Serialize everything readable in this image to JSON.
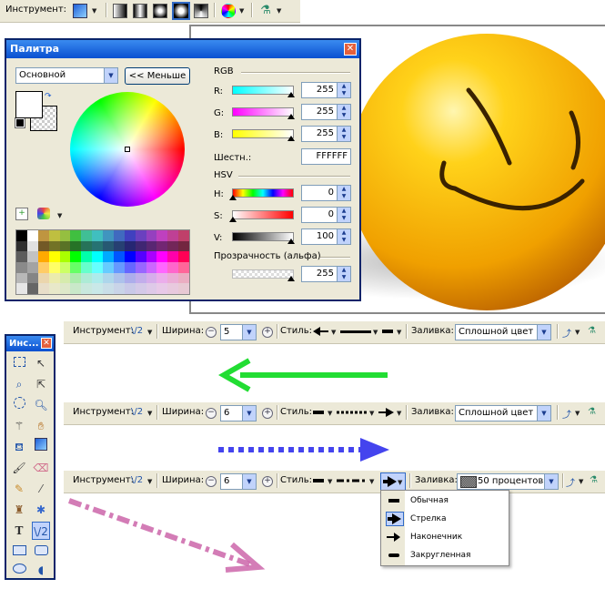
{
  "top_toolbar": {
    "tool_label": "Инструмент:"
  },
  "palette": {
    "title": "Палитра",
    "mode": "Основной",
    "less_button": "<< Меньше",
    "rgb_label": "RGB",
    "r_label": "R:",
    "g_label": "G:",
    "b_label": "B:",
    "r_value": "255",
    "g_value": "255",
    "b_value": "255",
    "hex_label": "Шестн.:",
    "hex_value": "FFFFFF",
    "hsv_label": "HSV",
    "h_label": "H:",
    "s_label": "S:",
    "v_label": "V:",
    "h_value": "0",
    "s_value": "0",
    "v_value": "100",
    "alpha_label": "Прозрачность (альфа)",
    "alpha_value": "255"
  },
  "tools_window": {
    "title": "Инс..."
  },
  "line_toolbars": [
    {
      "tool_label": "Инструмент:",
      "width_label": "Ширина:",
      "width_value": "5",
      "style_label": "Стиль:",
      "fill_label": "Заливка:",
      "fill_value": "Сплошной цвет"
    },
    {
      "tool_label": "Инструмент:",
      "width_label": "Ширина:",
      "width_value": "6",
      "style_label": "Стиль:",
      "fill_label": "Заливка:",
      "fill_value": "Сплошной цвет"
    },
    {
      "tool_label": "Инструмент:",
      "width_label": "Ширина:",
      "width_value": "6",
      "style_label": "Стиль:",
      "fill_label": "Заливка:",
      "fill_value": "50 процентов"
    }
  ],
  "cap_menu": {
    "items": [
      "Обычная",
      "Стрелка",
      "Наконечник",
      "Закругленная"
    ]
  },
  "colors": {
    "green_arrow": "#22dd33",
    "blue_arrow": "#4444ee",
    "pink_arrow": "#cc66aa"
  }
}
